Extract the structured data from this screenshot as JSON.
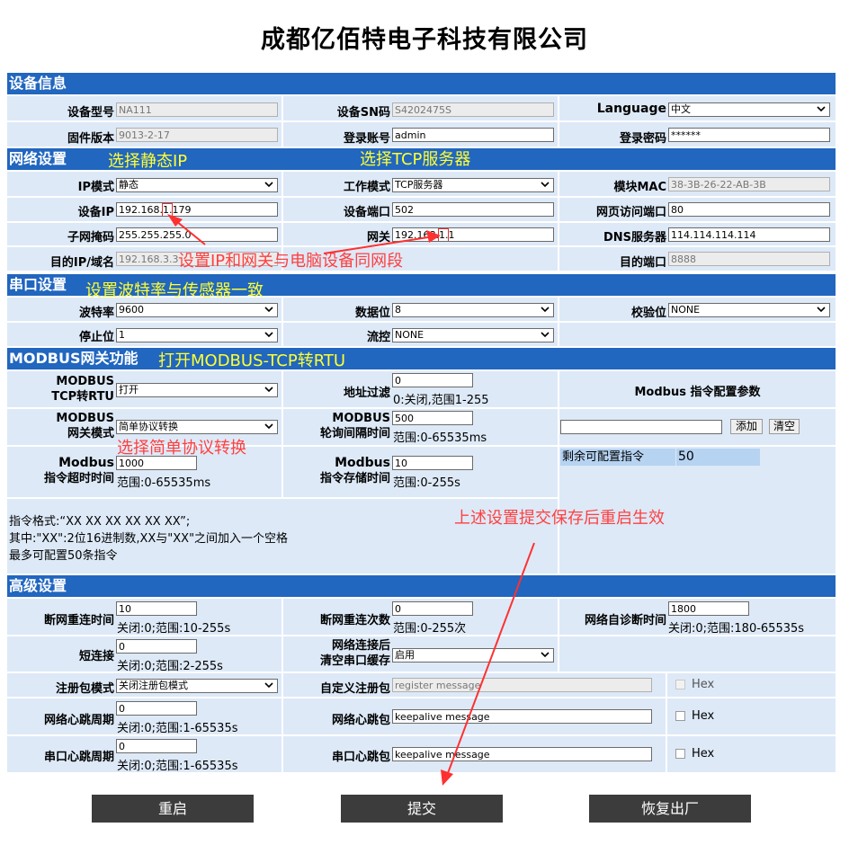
{
  "page_title": "成都亿佰特电子科技有限公司",
  "sections": {
    "device_info": "设备信息",
    "network": "网络设置",
    "serial": "串口设置",
    "modbus": "MODBUS网关功能",
    "advanced": "高级设置"
  },
  "device_info": {
    "model_label": "设备型号",
    "model_value": "NA111",
    "sn_label": "设备SN码",
    "sn_value": "S4202475S",
    "language_label": "Language",
    "language_value": "中文",
    "firmware_label": "固件版本",
    "firmware_value": "9013-2-17",
    "account_label": "登录账号",
    "account_value": "admin",
    "password_label": "登录密码",
    "password_value": "******"
  },
  "network": {
    "ip_mode_label": "IP模式",
    "ip_mode_value": "静态",
    "work_mode_label": "工作模式",
    "work_mode_value": "TCP服务器",
    "mac_label": "模块MAC",
    "mac_value": "38-3B-26-22-AB-3B",
    "ip_label": "设备IP",
    "ip_prefix": "192.168.",
    "ip_mid": "1.",
    "ip_suffix": "179",
    "port_label": "设备端口",
    "port_value": "502",
    "web_port_label": "网页访问端口",
    "web_port_value": "80",
    "mask_label": "子网掩码",
    "mask_value": "255.255.255.0",
    "gateway_label": "网关",
    "gateway_prefix": "192.168.",
    "gateway_mid": "1.",
    "gateway_suffix": "1",
    "dns_label": "DNS服务器",
    "dns_value": "114.114.114.114",
    "dest_ip_label": "目的IP/域名",
    "dest_ip_value": "192.168.3.3",
    "dest_port_label": "目的端口",
    "dest_port_value": "8888"
  },
  "serial": {
    "baud_label": "波特率",
    "baud_value": "9600",
    "data_bits_label": "数据位",
    "data_bits_value": "8",
    "parity_label": "校验位",
    "parity_value": "NONE",
    "stop_bits_label": "停止位",
    "stop_bits_value": "1",
    "flow_label": "流控",
    "flow_value": "NONE"
  },
  "modbus": {
    "tcp_rtu_label_1": "MODBUS",
    "tcp_rtu_label_2": "TCP转RTU",
    "tcp_rtu_value": "打开",
    "addr_filter_label": "地址过滤",
    "addr_filter_value": "0",
    "addr_filter_hint": "0:关闭,范围1-255",
    "config_title": "Modbus 指令配置参数",
    "gateway_mode_label_1": "MODBUS",
    "gateway_mode_label_2": "网关模式",
    "gateway_mode_value": "简单协议转换",
    "poll_label_1": "MODBUS",
    "poll_label_2": "轮询间隔时间",
    "poll_value": "500",
    "poll_hint": "范围:0-65535ms",
    "add_button": "添加",
    "clear_button": "清空",
    "timeout_label_1": "Modbus",
    "timeout_label_2": "指令超时时间",
    "timeout_value": "1000",
    "timeout_hint": "范围:0-65535ms",
    "store_label_1": "Modbus",
    "store_label_2": "指令存储时间",
    "store_value": "10",
    "store_hint": "范围:0-255s",
    "remaining_label": "剩余可配置指令",
    "remaining_value": "50",
    "format_line1": "指令格式:“XX XX XX XX XX XX”;",
    "format_line2": "其中:\"XX\":2位16进制数,XX与\"XX\"之间加入一个空格",
    "format_line3": "最多可配置50条指令"
  },
  "advanced": {
    "reconnect_time_label": "断网重连时间",
    "reconnect_time_value": "10",
    "reconnect_time_hint": "关闭:0;范围:10-255s",
    "reconnect_count_label": "断网重连次数",
    "reconnect_count_value": "0",
    "reconnect_count_hint": "范围:0-255次",
    "self_diag_label": "网络自诊断时间",
    "self_diag_value": "1800",
    "self_diag_hint": "关闭:0;范围:180-65535s",
    "short_conn_label": "短连接",
    "short_conn_value": "0",
    "short_conn_hint": "关闭:0;范围:2-255s",
    "clear_cache_label_1": "网络连接后",
    "clear_cache_label_2": "清空串口缓存",
    "clear_cache_value": "启用",
    "reg_mode_label": "注册包模式",
    "reg_mode_value": "关闭注册包模式",
    "custom_reg_label": "自定义注册包",
    "custom_reg_value": "register message",
    "hex_label": "Hex",
    "net_hb_period_label": "网络心跳周期",
    "net_hb_period_value": "0",
    "net_hb_period_hint": "关闭:0;范围:1-65535s",
    "net_hb_label": "网络心跳包",
    "net_hb_value": "keepalive message",
    "serial_hb_period_label": "串口心跳周期",
    "serial_hb_period_value": "0",
    "serial_hb_period_hint": "关闭:0;范围:1-65535s",
    "serial_hb_label": "串口心跳包",
    "serial_hb_value": "keepalive message"
  },
  "buttons": {
    "restart": "重启",
    "submit": "提交",
    "factory": "恢复出厂"
  },
  "annotations": {
    "static_ip": "选择静态IP",
    "tcp_server": "选择TCP服务器",
    "same_segment": "设置IP和网关与电脑设备同网段",
    "baud_match": "设置波特率与传感器一致",
    "open_modbus": "打开MODBUS-TCP转RTU",
    "simple_protocol": "选择简单协议转换",
    "save_restart": "上述设置提交保存后重启生效"
  },
  "colors": {
    "section_blue": "#2166bf",
    "row_bg": "#dde9f7",
    "annotation_red": "#ff4040",
    "annotation_yellow": "#ffff33",
    "button_dark": "#3c3c3c"
  }
}
